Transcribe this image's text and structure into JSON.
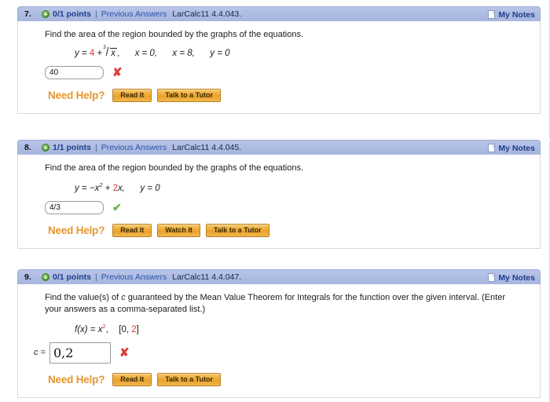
{
  "questions": [
    {
      "number": "7.",
      "points": "0/1 points",
      "separator": "|",
      "previous_answers": "Previous Answers",
      "reference": "LarCalc11 4.4.043.",
      "my_notes": "My Notes",
      "prompt": "Find the area of the region bounded by the graphs of the equations.",
      "equation": {
        "lhs": "y",
        "eq": "=",
        "coef": "4",
        "plus": "+",
        "root_index": "3",
        "root_radicand": "x",
        "comma": ",",
        "term2": "x = 0,",
        "term3": "x = 8,",
        "term4": "y = 0"
      },
      "answer_value": "40",
      "answer_placeholder": "",
      "result_mark": "✘",
      "result_state": "wrong",
      "help_label": "Need Help?",
      "help_buttons": [
        "Read It",
        "Talk to a Tutor"
      ]
    },
    {
      "number": "8.",
      "points": "1/1 points",
      "separator": "|",
      "previous_answers": "Previous Answers",
      "reference": "LarCalc11 4.4.045.",
      "my_notes": "My Notes",
      "prompt": "Find the area of the region bounded by the graphs of the equations.",
      "equation": {
        "lhs": "y",
        "eq": "=",
        "neg_term": "−x",
        "exp": "2",
        "plus": "+",
        "coef": "2",
        "var": "x,",
        "term2": "y = 0"
      },
      "answer_value": "4/3",
      "answer_placeholder": "",
      "result_mark": "✔",
      "result_state": "right",
      "help_label": "Need Help?",
      "help_buttons": [
        "Read It",
        "Watch It",
        "Talk to a Tutor"
      ]
    },
    {
      "number": "9.",
      "points": "0/1 points",
      "separator": "|",
      "previous_answers": "Previous Answers",
      "reference": "LarCalc11 4.4.047.",
      "my_notes": "My Notes",
      "prompt_part1": "Find the value(s) of ",
      "prompt_var": "c",
      "prompt_part2": " guaranteed by the Mean Value Theorem for Integrals for the function over the given interval. (Enter your answers as a comma-separated list.)",
      "equation": {
        "fx": "f(x)",
        "eq": "=",
        "base": "x",
        "exp": "2",
        "comma": ",",
        "interval_open": "[0,",
        "interval_red": "2",
        "interval_close": "]"
      },
      "input_label": "c =",
      "answer_value": "0,2",
      "answer_placeholder": "",
      "result_mark": "✘",
      "result_state": "wrong",
      "help_label": "Need Help?",
      "help_buttons": [
        "Read It",
        "Talk to a Tutor"
      ]
    }
  ],
  "colors": {
    "header_bg": "#aebce3",
    "link": "#2b53a8",
    "points": "#1f3e8c",
    "red_number": "#d93b2b",
    "help_orange": "#e8962e",
    "button_orange": "#eeab37",
    "wrong": "#e03b33",
    "right": "#6cb24e"
  }
}
